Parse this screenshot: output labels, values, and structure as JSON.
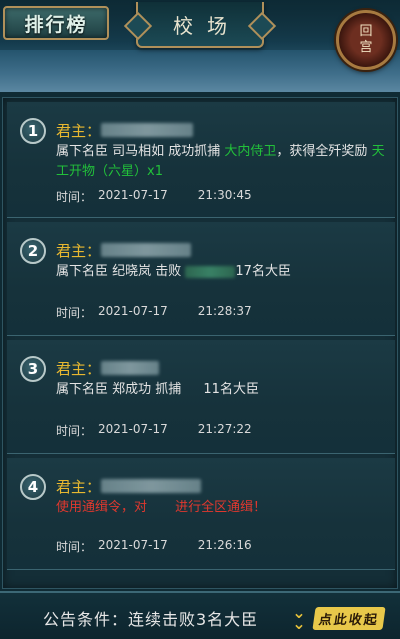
{
  "header": {
    "rank_button": "排行榜",
    "title": "校场",
    "palace_button": [
      "回",
      "宫"
    ]
  },
  "lord_label": "君主：",
  "time_label": "时间：",
  "notices": [
    {
      "number": "1",
      "text_parts": [
        "属下名臣 司马相如 成功抓捕 ",
        "大内侍卫",
        "，获得全歼奖励 ",
        "天工开物（六星）x1"
      ],
      "date": "2021-07-17",
      "time": "21:30:45"
    },
    {
      "number": "2",
      "text_parts": [
        "属下名臣 纪晓岚 击败 ",
        "17名大臣"
      ],
      "date": "2021-07-17",
      "time": "21:28:37"
    },
    {
      "number": "3",
      "text_parts": [
        "属下名臣 郑成功 抓捕 ",
        "11名大臣"
      ],
      "date": "2021-07-17",
      "time": "21:27:22"
    },
    {
      "number": "4",
      "text_parts": [
        "使用通缉令，对 ",
        "进行全区通缉！"
      ],
      "date": "2021-07-17",
      "time": "21:26:16"
    }
  ],
  "footer": {
    "condition": "公告条件：连续击败3名大臣",
    "collapse_label": "点此收起"
  },
  "colors": {
    "gold": "#e8b830",
    "green": "#22c03a",
    "red": "#e0382e"
  }
}
